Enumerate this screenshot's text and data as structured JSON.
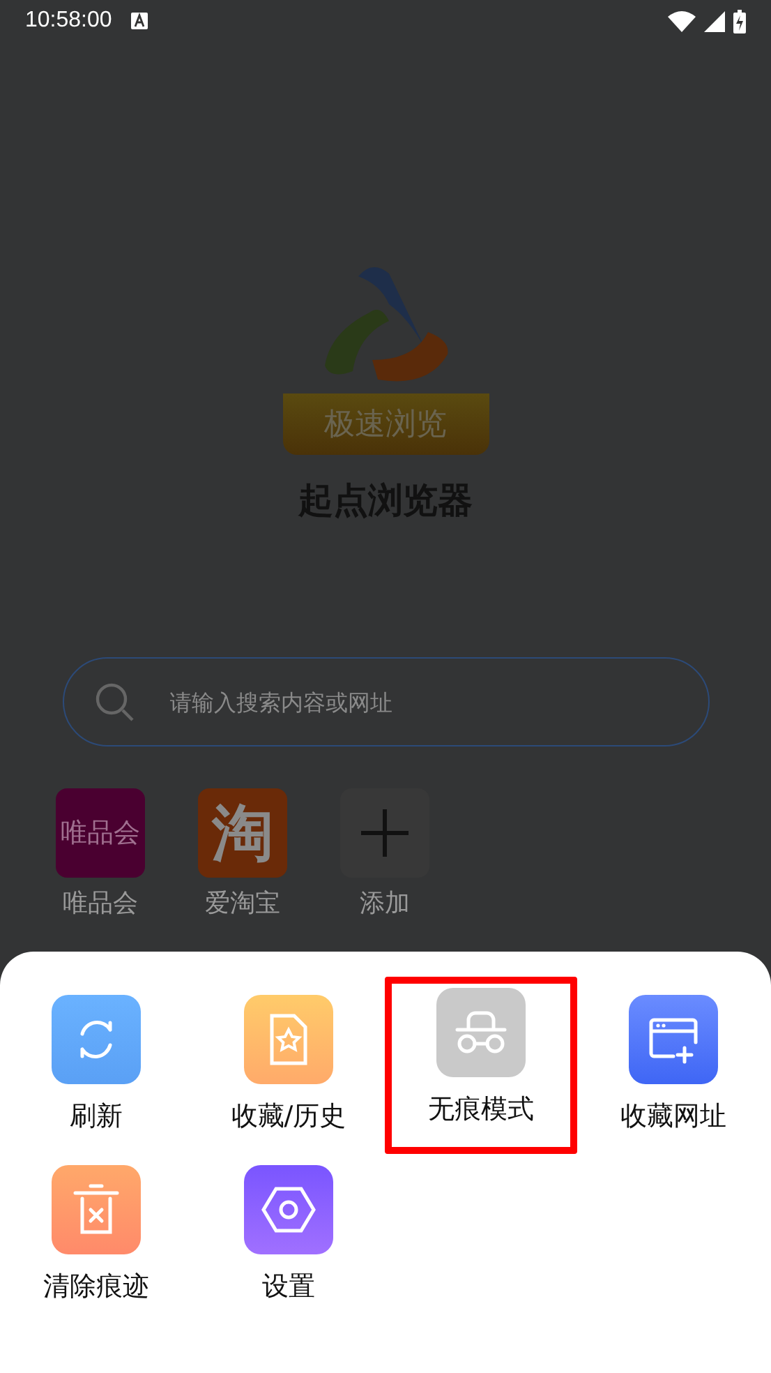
{
  "status_bar": {
    "time": "10:58:00"
  },
  "home": {
    "logo_text": "极速浏览",
    "title": "起点浏览器",
    "search": {
      "placeholder": "请输入搜索内容或网址"
    },
    "shortcuts": [
      {
        "kind": "text_tile",
        "icon_text": "唯品会",
        "label": "唯品会",
        "color": "#4a0030"
      },
      {
        "kind": "glyph_tile",
        "icon_text": "淘",
        "label": "爱淘宝",
        "color": "#6a2a08"
      },
      {
        "kind": "add",
        "label": "添加",
        "color": "#383838"
      }
    ]
  },
  "menu": {
    "items": [
      {
        "kind": "refresh",
        "label": "刷新",
        "highlighted": false
      },
      {
        "kind": "favorites",
        "label": "收藏/历史",
        "highlighted": false
      },
      {
        "kind": "incognito",
        "label": "无痕模式",
        "highlighted": true
      },
      {
        "kind": "bookmark_add",
        "label": "收藏网址",
        "highlighted": false
      },
      {
        "kind": "clear",
        "label": "清除痕迹",
        "highlighted": false
      },
      {
        "kind": "settings",
        "label": "设置",
        "highlighted": false
      }
    ]
  }
}
